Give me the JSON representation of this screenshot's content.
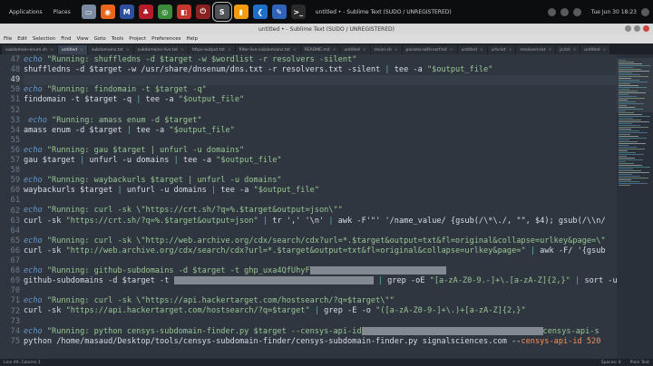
{
  "panel": {
    "apps_label": "Applications",
    "places_label": "Places",
    "title": "untitled • - Sublime Text (SUDO / UNREGISTERED)",
    "clock": "Tue Jun 30 18:23",
    "launcher_icons": [
      {
        "name": "files-icon",
        "color": "#7a8aa0",
        "glyph": "▭"
      },
      {
        "name": "firefox-icon",
        "color": "#e8651c",
        "glyph": "◉"
      },
      {
        "name": "malwarebytes-icon",
        "color": "#2d4f9e",
        "glyph": "M"
      },
      {
        "name": "cherrytree-icon",
        "color": "#b51c2a",
        "glyph": "♣"
      },
      {
        "name": "chrome-icon",
        "color": "#3d8c3d",
        "glyph": "◎"
      },
      {
        "name": "burp-icon",
        "color": "#c4362e",
        "glyph": "◧"
      },
      {
        "name": "shutdown-icon",
        "color": "#8a2020",
        "glyph": "⏻"
      },
      {
        "name": "sublime-icon",
        "color": "#4f5358",
        "glyph": "S"
      },
      {
        "name": "sublime-merge-icon",
        "color": "#f39c12",
        "glyph": "▮"
      },
      {
        "name": "vscode-icon",
        "color": "#1f6fc9",
        "glyph": "❮"
      },
      {
        "name": "editor-icon",
        "color": "#2f63b8",
        "glyph": "✎"
      },
      {
        "name": "terminal-icon",
        "color": "#2a2a2a",
        "glyph": ">_"
      }
    ]
  },
  "window": {
    "title": "untitled • - Sublime Text (SUDO / UNREGISTERED)"
  },
  "menu": [
    "File",
    "Edit",
    "Selection",
    "Find",
    "View",
    "Goto",
    "Tools",
    "Project",
    "Preferences",
    "Help"
  ],
  "tabs": [
    {
      "label": "subdomain-enum.sh",
      "active": false
    },
    {
      "label": "untitled",
      "active": true
    },
    {
      "label": "subdomains.txt",
      "active": false
    },
    {
      "label": "subdomains-live.txt",
      "active": false
    },
    {
      "label": "httpx-output.txt",
      "active": false
    },
    {
      "label": "filter-live-subdomains.txt",
      "active": false
    },
    {
      "label": "README.md",
      "active": false
    },
    {
      "label": "untitled",
      "active": false
    },
    {
      "label": "recon.sh",
      "active": false
    },
    {
      "label": "params-with-ssrf.txt",
      "active": false
    },
    {
      "label": "untitled",
      "active": false
    },
    {
      "label": "urls.txt",
      "active": false
    },
    {
      "label": "resolvers.txt",
      "active": false
    },
    {
      "label": "js.txt",
      "active": false
    },
    {
      "label": "untitled",
      "active": false
    }
  ],
  "lines": [
    {
      "n": "47",
      "segs": [
        [
          "echo ",
          "echo"
        ],
        [
          "\"Running: shuffledns -d $target -w $wordlist -r resolvers -silent\"",
          "str"
        ]
      ]
    },
    {
      "n": "48",
      "segs": [
        [
          "shuffledns -d $target -w /usr/share/dnsenum/dns.txt -r resolvers.txt -silent ",
          "cmd"
        ],
        [
          "| ",
          "pipe"
        ],
        [
          "tee -a ",
          "cmd"
        ],
        [
          "\"$output_file\"",
          "str"
        ]
      ]
    },
    {
      "n": "49",
      "current": true,
      "segs": []
    },
    {
      "n": "50",
      "segs": [
        [
          "echo ",
          "echo"
        ],
        [
          "\"Running: findomain -t $target -q\"",
          "str"
        ]
      ]
    },
    {
      "n": "51",
      "segs": [
        [
          "findomain -t $target -q ",
          "cmd"
        ],
        [
          "| ",
          "pipe"
        ],
        [
          "tee -a ",
          "cmd"
        ],
        [
          "\"$output_file\"",
          "str"
        ]
      ]
    },
    {
      "n": "52",
      "segs": []
    },
    {
      "n": "53",
      "segs": [
        [
          " echo ",
          "echo"
        ],
        [
          "\"Running: amass enum -d $target\"",
          "str"
        ]
      ]
    },
    {
      "n": "54",
      "segs": [
        [
          "amass enum -d $target ",
          "cmd"
        ],
        [
          "| ",
          "pipe"
        ],
        [
          "tee -a ",
          "cmd"
        ],
        [
          "\"$output_file\"",
          "str"
        ]
      ]
    },
    {
      "n": "55",
      "segs": []
    },
    {
      "n": "56",
      "segs": [
        [
          "echo ",
          "echo"
        ],
        [
          "\"Running: gau $target | unfurl -u domains\"",
          "str"
        ]
      ]
    },
    {
      "n": "57",
      "segs": [
        [
          "gau $target ",
          "cmd"
        ],
        [
          "| ",
          "pipe"
        ],
        [
          "unfurl -u domains ",
          "cmd"
        ],
        [
          "| ",
          "pipe"
        ],
        [
          "tee -a ",
          "cmd"
        ],
        [
          "\"$output_file\"",
          "str"
        ]
      ]
    },
    {
      "n": "58",
      "segs": []
    },
    {
      "n": "59",
      "segs": [
        [
          "echo ",
          "echo"
        ],
        [
          "\"Running: waybackurls $target | unfurl -u domains\"",
          "str"
        ]
      ]
    },
    {
      "n": "60",
      "segs": [
        [
          "waybackurls $target ",
          "cmd"
        ],
        [
          "| ",
          "pipe"
        ],
        [
          "unfurl -u domains ",
          "cmd"
        ],
        [
          "| ",
          "pipe"
        ],
        [
          "tee -a ",
          "cmd"
        ],
        [
          "\"$output_file\"",
          "str"
        ]
      ]
    },
    {
      "n": "61",
      "segs": []
    },
    {
      "n": "62",
      "segs": [
        [
          "echo ",
          "echo"
        ],
        [
          "\"Running: curl -sk \\\"https://crt.sh/?q=%.$target&output=json\\\"\"",
          "str"
        ]
      ]
    },
    {
      "n": "63",
      "segs": [
        [
          "curl -sk ",
          "cmd"
        ],
        [
          "\"https://crt.sh/?q=%.$target&output=json\"",
          "str"
        ],
        [
          " ",
          "cmd"
        ],
        [
          "| ",
          "pipe"
        ],
        [
          "tr ',' '\\n' ",
          "cmd"
        ],
        [
          "| ",
          "pipe"
        ],
        [
          "awk -F'\"' '/name_value/ {gsub(/\\*\\./, \"\", $4); gsub(/\\\\n/",
          "cmd"
        ]
      ]
    },
    {
      "n": "64",
      "segs": []
    },
    {
      "n": "65",
      "segs": [
        [
          "echo ",
          "echo"
        ],
        [
          "\"Running: curl -sk \\\"http://web.archive.org/cdx/search/cdx?url=*.$target&output=txt&fl=original&collapse=urlkey&page=\\\"",
          "str"
        ]
      ]
    },
    {
      "n": "66",
      "segs": [
        [
          "curl -sk ",
          "cmd"
        ],
        [
          "\"http://web.archive.org/cdx/search/cdx?url=*.$target&output=txt&fl=original&collapse=urlkey&page=\"",
          "str"
        ],
        [
          " ",
          "cmd"
        ],
        [
          "| ",
          "pipe"
        ],
        [
          "awk -F/ '{gsub",
          "cmd"
        ]
      ]
    },
    {
      "n": "67",
      "segs": []
    },
    {
      "n": "68",
      "segs": [
        [
          "echo ",
          "echo"
        ],
        [
          "\"Running: github-subdomains -d $target -t ghp_uxa4QfUhyF",
          "str"
        ],
        [
          "REDACT:150",
          "redact"
        ]
      ]
    },
    {
      "n": "69",
      "segs": [
        [
          "github-subdomains -d $target -t ",
          "cmd"
        ],
        [
          "REDACT:220",
          "redact"
        ],
        [
          " | ",
          "pipe"
        ],
        [
          "grep -oE ",
          "cmd"
        ],
        [
          "\"[a-zA-Z0-9.-]+\\.[a-zA-Z]{2,}\"",
          "str"
        ],
        [
          " | ",
          "pipe"
        ],
        [
          "sort -u",
          "cmd"
        ]
      ]
    },
    {
      "n": "70",
      "segs": []
    },
    {
      "n": "71",
      "segs": [
        [
          "echo ",
          "echo"
        ],
        [
          "\"Running: curl -sk \\\"https://api.hackertarget.com/hostsearch/?q=$target\\\"\"",
          "str"
        ]
      ]
    },
    {
      "n": "72",
      "segs": [
        [
          "curl -sk ",
          "cmd"
        ],
        [
          "\"https://api.hackertarget.com/hostsearch/?q=$target\"",
          "str"
        ],
        [
          " ",
          "cmd"
        ],
        [
          "| ",
          "pipe"
        ],
        [
          "grep -E -o ",
          "cmd"
        ],
        [
          "\"([a-zA-Z0-9-]+\\.)+[a-zA-Z]{2,}\"",
          "str"
        ]
      ]
    },
    {
      "n": "73",
      "segs": []
    },
    {
      "n": "74",
      "segs": [
        [
          "echo ",
          "echo"
        ],
        [
          "\"Running: python censys-subdomain-finder.py $target --censys-api-id",
          "str"
        ],
        [
          "REDACT:200",
          "redact"
        ],
        [
          "censys-api-s",
          "str"
        ]
      ]
    },
    {
      "n": "75",
      "segs": [
        [
          "python /home/masaud/Desktop/tools/censys-subdomain-finder/censys-subdomain-finder.py signalsciences.com --",
          "cmd"
        ],
        [
          "censys-api-id 520",
          "sym"
        ]
      ]
    }
  ],
  "status": {
    "left": "Line 49, Column 1",
    "tab_size": "Spaces: 4",
    "syntax": "Plain Text"
  },
  "colors": {
    "editor_bg": "#2f3640",
    "string": "#99c794",
    "keyword": "#6699cc",
    "pipe": "#5fb3b3"
  }
}
